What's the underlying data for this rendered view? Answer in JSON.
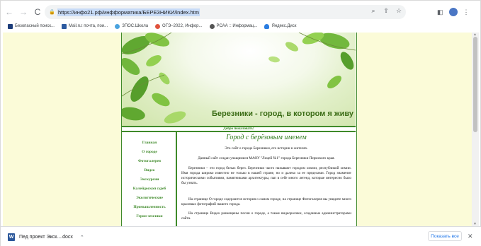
{
  "browser": {
    "url": "https://инфо21.рф/инфформатика/БЕРЕЗНИКИ/index.htm",
    "back_icon": "←",
    "forward_icon": "→",
    "reload_icon": "C",
    "lock_icon": "🔒",
    "omni_icons": [
      "⌕",
      "⇪",
      "☆"
    ],
    "right_icons": [
      "◧",
      "⋮"
    ]
  },
  "bookmarks": [
    {
      "label": "Безопасный поиск...",
      "color": "#1d3d7a"
    },
    {
      "label": "Mail.ru: почта, пои...",
      "color": "#2c5aa0"
    },
    {
      "label": "ЗПОС.Школа",
      "color": "#4aa3df"
    },
    {
      "label": "ОГЭ–2022, Инфор...",
      "color": "#e0533d"
    },
    {
      "label": "РСАА :: Информац...",
      "color": "#555555"
    },
    {
      "label": "Яндекс.Диск",
      "color": "#2a7de1"
    }
  ],
  "site": {
    "banner_title": "Березники - город, в котором я живу",
    "welcome": "Добро пожаловать!",
    "nav": [
      "Главная",
      "О городе",
      "Фотогалерея",
      "Видео",
      "Экскурсии",
      "Калейдоскоп судеб",
      "Экологические",
      "Промышленность",
      "Герои-земляки"
    ],
    "content_title": "Город с берёзовым именем",
    "paragraphs": [
      "Это сайт о городе Березники, его истории и жителях.",
      "Данный сайт создан учащимися МАОУ \"Лицей №1\" города Березники Пермского края.",
      "Березники – это город белых берез. Березники часто называют городом химии, республикой химии. Имя города широко известно не только в нашей стране, но и далеко за ее пределами. Город знаменит историческими событиями, памятниками архитектуры, пап в себе много легенд, которые интересно было бы узнать.",
      "На странице О городе содержится история о самом городе, на странице Фотогалерея вы увидите много красивых фотографий нашего города.",
      "На странице Видео размещены песни о городе, а также видеоролики, созданные администраторами сайта."
    ]
  },
  "downloads": {
    "file_name": "Пед проект Экск....docx",
    "file_icon": "W",
    "chevron": "⌃",
    "show_all": "Показать все",
    "close_icon": "✕"
  }
}
